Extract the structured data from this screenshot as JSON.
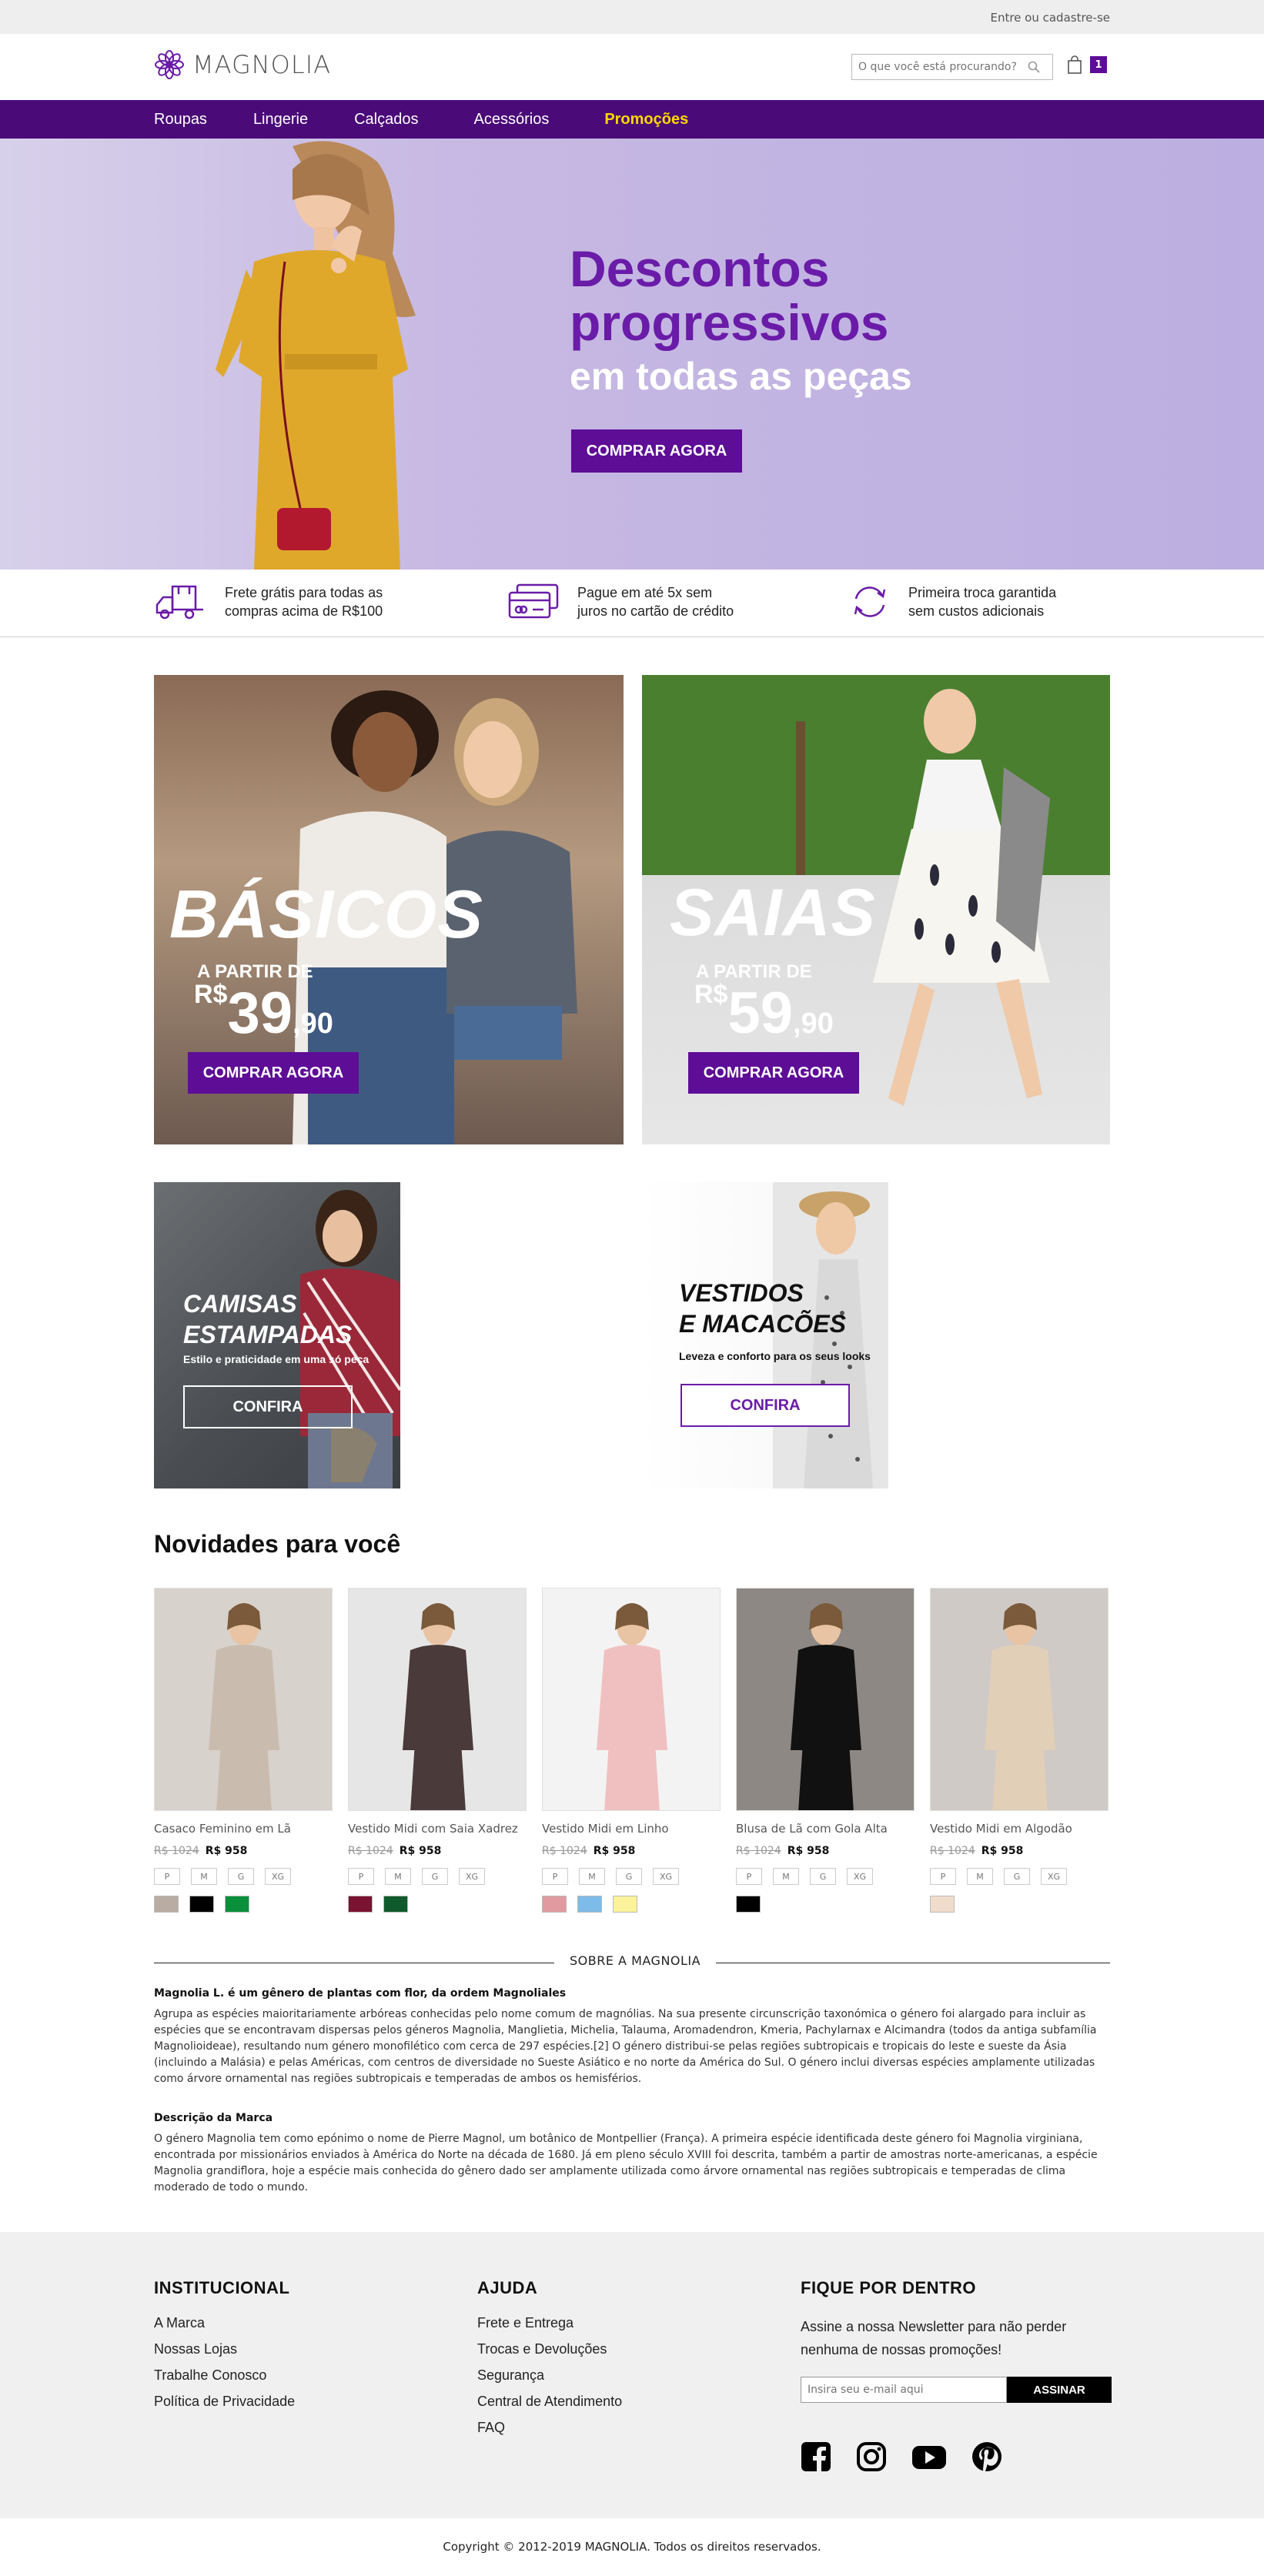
{
  "topbar": {
    "login": "Entre ou cadastre-se"
  },
  "header": {
    "brand": "MAGNOLIA",
    "search_placeholder": "O que você está procurando?",
    "cart_count": "1"
  },
  "nav": {
    "items": [
      {
        "label": "Roupas"
      },
      {
        "label": "Lingerie"
      },
      {
        "label": "Calçados"
      },
      {
        "label": "Acessórios"
      },
      {
        "label": "Promoções"
      }
    ]
  },
  "hero": {
    "title_line1": "Descontos",
    "title_line2": "progressivos",
    "subtitle": "em todas as peças",
    "cta": "COMPRAR AGORA"
  },
  "benefits": [
    {
      "line1": "Frete grátis para todas as",
      "line2": "compras acima de R$100",
      "icon": "truck-icon"
    },
    {
      "line1": "Pague em até 5x sem",
      "line2": "juros no cartão de crédito",
      "icon": "credit-card-icon"
    },
    {
      "line1": "Primeira troca garantida",
      "line2": "sem custos adicionais",
      "icon": "exchange-icon"
    }
  ],
  "tiles": {
    "basicos": {
      "title": "BÁSICOS",
      "from": "A PARTIR DE",
      "currency": "R$",
      "price": "39",
      "cents": ",90",
      "cta": "COMPRAR AGORA"
    },
    "saias": {
      "title": "SAIAS",
      "from": "A PARTIR DE",
      "currency": "R$",
      "price": "59",
      "cents": ",90",
      "cta": "COMPRAR AGORA"
    },
    "camisas": {
      "title_line1": "CAMISAS",
      "title_line2": "ESTAMPADAS",
      "sub": "Estilo e praticidade em uma só peça",
      "cta": "CONFIRA"
    },
    "vestidos": {
      "title_line1": "VESTIDOS",
      "title_line2": "E MACACÕES",
      "sub": "Leveza e conforto para os seus looks",
      "cta": "CONFIRA"
    }
  },
  "products_section": {
    "title": "Novidades para você"
  },
  "products": [
    {
      "name": "Casaco Feminino em Lã",
      "old_price": "R$ 1024",
      "price": "R$ 958",
      "sizes": [
        "P",
        "M",
        "G",
        "XG"
      ],
      "colors": [
        "#b9ada3",
        "#000000",
        "#0a8f3a"
      ]
    },
    {
      "name": "Vestido Midi com Saia Xadrez",
      "old_price": "R$ 1024",
      "price": "R$ 958",
      "sizes": [
        "P",
        "M",
        "G",
        "XG"
      ],
      "colors": [
        "#7a1232",
        "#0f5a2a"
      ]
    },
    {
      "name": "Vestido Midi em Linho",
      "old_price": "R$ 1024",
      "price": "R$ 958",
      "sizes": [
        "P",
        "M",
        "G",
        "XG"
      ],
      "colors": [
        "#e19aa0",
        "#7dbbe8",
        "#fbf29a"
      ]
    },
    {
      "name": "Blusa de Lã com Gola Alta",
      "old_price": "R$ 1024",
      "price": "R$ 958",
      "sizes": [
        "P",
        "M",
        "G",
        "XG"
      ],
      "colors": [
        "#000000"
      ]
    },
    {
      "name": "Vestido Midi em Algodão",
      "old_price": "R$ 1024",
      "price": "R$ 958",
      "sizes": [
        "P",
        "M",
        "G",
        "XG"
      ],
      "colors": [
        "#f0dccb"
      ]
    }
  ],
  "about": {
    "label": "SOBRE A MAGNOLIA",
    "h1": "Magnolia L. é um gênero de plantas com flor, da ordem Magnoliales",
    "p1": "Agrupa as espécies maioritariamente arbóreas conhecidas pelo nome comum de magnólias. Na sua presente circunscrição taxonómica o género foi alargado para incluir as espécies que se encontravam dispersas pelos géneros Magnolia, Manglietia, Michelia, Talauma, Aromadendron, Kmeria, Pachylarnax e Alcimandra (todos da antiga subfamília Magnolioideae), resultando num género monofilético com cerca de 297 espécies.[2] O género distribui-se pelas regiões subtropicais e tropicais do leste e sueste da Ásia (incluindo a Malásia) e pelas Américas, com centros de diversidade no Sueste Asiático e no norte da América do Sul. O género inclui diversas espécies amplamente utilizadas como árvore ornamental nas regiões subtropicais e temperadas de ambos os hemisférios.",
    "h2": "Descrição da Marca",
    "p2": "O género Magnolia tem como epónimo o nome de Pierre Magnol, um botânico de Montpellier (França). A primeira espécie identificada deste género foi Magnolia virginiana, encontrada por missionários enviados à América do Norte na década de 1680. Já em pleno século XVIII foi descrita, também a partir de amostras norte-americanas, a espécie Magnolia grandiflora, hoje a espécie mais conhecida do gênero dado ser amplamente utilizada como árvore ornamental nas regiões subtropicais e temperadas de clima moderado de todo o mundo."
  },
  "footer": {
    "institucional": {
      "title": "INSTITUCIONAL",
      "links": [
        "A Marca",
        "Nossas Lojas",
        "Trabalhe Conosco",
        "Política de Privacidade"
      ]
    },
    "ajuda": {
      "title": "AJUDA",
      "links": [
        "Frete e Entrega",
        "Trocas e Devoluções",
        "Segurança",
        "Central de Atendimento",
        "FAQ"
      ]
    },
    "newsletter": {
      "title": "FIQUE POR DENTRO",
      "text": "Assine a nossa Newsletter para não perder nenhuma de nossas promoções!",
      "placeholder": "Insira seu e-mail aqui",
      "button": "ASSINAR"
    },
    "socials": [
      "facebook-icon",
      "instagram-icon",
      "youtube-icon",
      "pinterest-icon"
    ]
  },
  "copyright": "Copyright © 2012-2019 MAGNOLIA. Todos os direitos reservados.",
  "colors": {
    "brand_purple": "#5e0d97",
    "nav_purple": "#4a0a78",
    "promo_yellow": "#ffd700"
  }
}
